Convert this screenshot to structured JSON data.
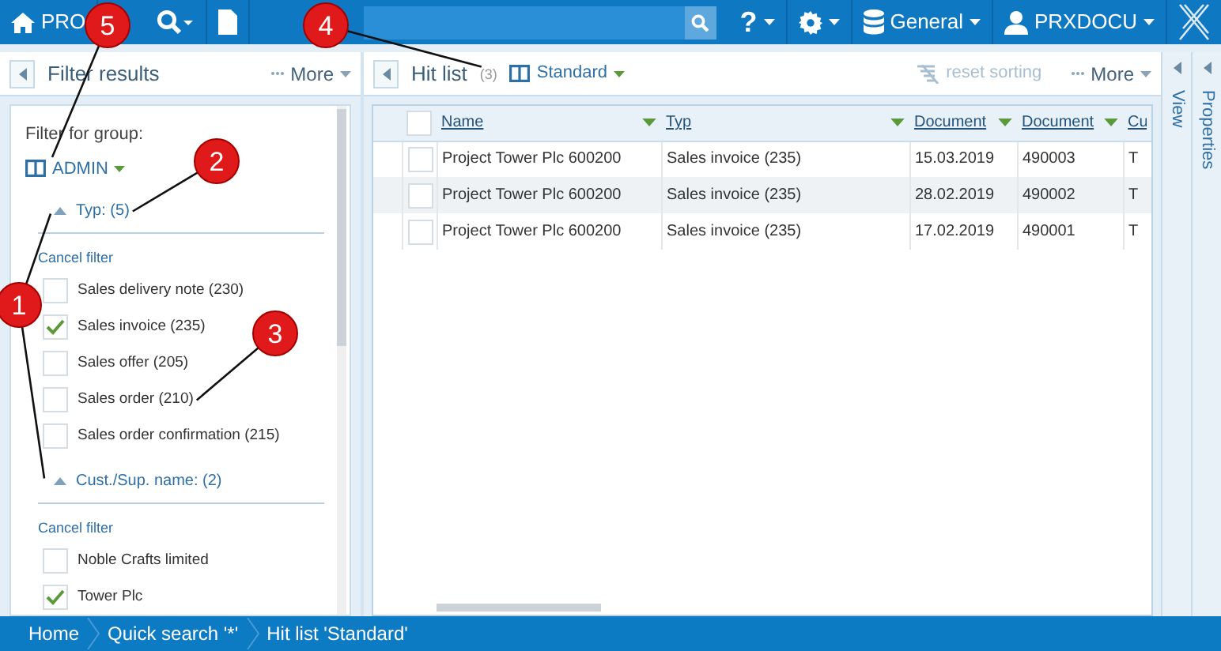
{
  "topbar": {
    "brand": "PRO",
    "menus": [
      {
        "kind": "help",
        "label": "?"
      },
      {
        "kind": "settings"
      },
      {
        "kind": "database",
        "label": "General"
      },
      {
        "kind": "user",
        "label": "PRXDOCU"
      }
    ]
  },
  "filter_panel": {
    "title": "Filter results",
    "more": "More",
    "group_label": "Filter for group:",
    "group": "ADMIN",
    "sections": [
      {
        "title": "Typ: (5)",
        "expanded": true,
        "cancel": "Cancel filter",
        "items": [
          {
            "label": "Sales delivery note (230)",
            "checked": false
          },
          {
            "label": "Sales invoice (235)",
            "checked": true
          },
          {
            "label": "Sales offer (205)",
            "checked": false
          },
          {
            "label": "Sales order (210)",
            "checked": false
          },
          {
            "label": "Sales order confirmation (215)",
            "checked": false
          }
        ]
      },
      {
        "title": "Cust./Sup. name: (2)",
        "expanded": true,
        "cancel": "Cancel filter",
        "items": [
          {
            "label": "Noble Crafts limited",
            "checked": false
          },
          {
            "label": "Tower Plc",
            "checked": true
          }
        ]
      }
    ]
  },
  "hit_list": {
    "title": "Hit list",
    "count": "(3)",
    "view": "Standard",
    "reset": {
      "label": "reset sorting",
      "disabled": true
    },
    "more": "More",
    "select_all": false,
    "columns": [
      "Name",
      "Typ",
      "Document",
      "Document",
      "Cu"
    ],
    "rows": [
      {
        "cells": [
          "Project Tower Plc 600200",
          "Sales invoice (235)",
          "15.03.2019",
          "490003",
          "T"
        ],
        "checked": false,
        "selected": false
      },
      {
        "cells": [
          "Project Tower Plc 600200",
          "Sales invoice (235)",
          "28.02.2019",
          "490002",
          "T"
        ],
        "checked": false,
        "selected": true
      },
      {
        "cells": [
          "Project Tower Plc 600200",
          "Sales invoice (235)",
          "17.02.2019",
          "490001",
          "T"
        ],
        "checked": false,
        "selected": false
      }
    ]
  },
  "side_tabs": [
    "View",
    "Properties"
  ],
  "breadcrumb": [
    "Home",
    "Quick search '*'",
    "Hit list 'Standard'"
  ],
  "annotations": [
    {
      "label": "5"
    },
    {
      "label": "4"
    },
    {
      "label": "2"
    },
    {
      "label": "3"
    },
    {
      "label": "1"
    }
  ]
}
